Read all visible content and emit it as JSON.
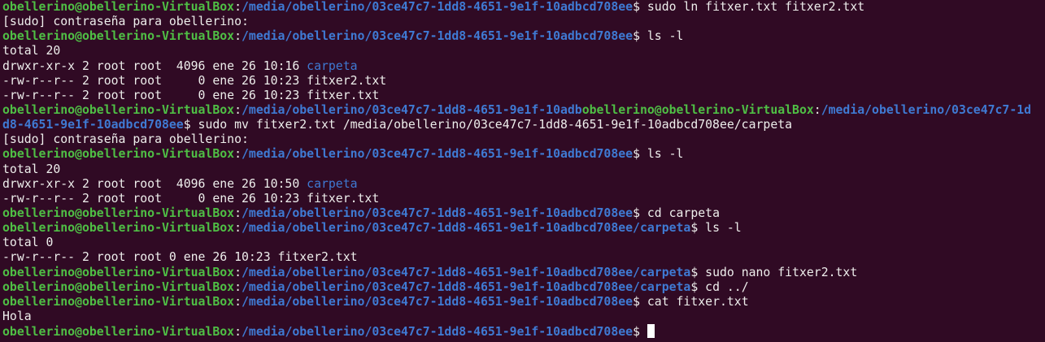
{
  "colors": {
    "background": "#300a24",
    "user_host": "#4fbf45",
    "path": "#3f7ad3",
    "text": "#eeeeec",
    "directory": "#3f7ad3"
  },
  "prompt": {
    "user_host": "obellerino@obellerino-VirtualBox",
    "separator": ":",
    "base_path": "/media/obellerino/03ce47c7-1dd8-4651-9e1f-10adbcd708ee",
    "sub_path": "/media/obellerino/03ce47c7-1dd8-4651-9e1f-10adbcd708ee/carpeta",
    "symbol": "$ "
  },
  "lines": [
    {
      "type": "prompt",
      "path": "base",
      "cmd": "sudo ln fitxer.txt fitxer2.txt"
    },
    {
      "type": "text",
      "text": "[sudo] contraseña para obellerino:"
    },
    {
      "type": "prompt",
      "path": "base",
      "cmd": "ls -l"
    },
    {
      "type": "text",
      "text": "total 20"
    },
    {
      "type": "ls",
      "text": "drwxr-xr-x 2 root root  4096 ene 26 10:16 ",
      "name": "carpeta",
      "dir": true
    },
    {
      "type": "ls",
      "text": "-rw-r--r-- 2 root root     0 ene 26 10:23 ",
      "name": "fitxer2.txt",
      "dir": false
    },
    {
      "type": "ls",
      "text": "-rw-r--r-- 2 root root     0 ene 26 10:23 ",
      "name": "fitxer.txt",
      "dir": false
    },
    {
      "type": "wrap1",
      "user": "obellerino@obellerino-VirtualBox",
      "path": "/media/obellerino/03ce47c7-1dd8-4651-9e1f-10adb",
      "user2": "obellerino@obellerino-VirtualBox",
      "path2": "/media/obellerino/03ce47c7-1d"
    },
    {
      "type": "wrap2",
      "path": "d8-4651-9e1f-10adbcd708ee",
      "cmd": "sudo mv fitxer2.txt /media/obellerino/03ce47c7-1dd8-4651-9e1f-10adbcd708ee/carpeta"
    },
    {
      "type": "text",
      "text": "[sudo] contraseña para obellerino:"
    },
    {
      "type": "prompt",
      "path": "base",
      "cmd": "ls -l"
    },
    {
      "type": "text",
      "text": "total 20"
    },
    {
      "type": "ls",
      "text": "drwxr-xr-x 2 root root  4096 ene 26 10:50 ",
      "name": "carpeta",
      "dir": true
    },
    {
      "type": "ls",
      "text": "-rw-r--r-- 2 root root     0 ene 26 10:23 ",
      "name": "fitxer.txt",
      "dir": false
    },
    {
      "type": "prompt",
      "path": "base",
      "cmd": "cd carpeta"
    },
    {
      "type": "prompt",
      "path": "sub",
      "cmd": "ls -l"
    },
    {
      "type": "text",
      "text": "total 0"
    },
    {
      "type": "text",
      "text": "-rw-r--r-- 2 root root 0 ene 26 10:23 fitxer2.txt"
    },
    {
      "type": "prompt",
      "path": "sub",
      "cmd": "sudo nano fitxer2.txt"
    },
    {
      "type": "prompt",
      "path": "sub",
      "cmd": "cd ../"
    },
    {
      "type": "prompt",
      "path": "base",
      "cmd": "cat fitxer.txt"
    },
    {
      "type": "text",
      "text": "Hola"
    },
    {
      "type": "prompt",
      "path": "base",
      "cmd": "",
      "cursor": true
    }
  ]
}
